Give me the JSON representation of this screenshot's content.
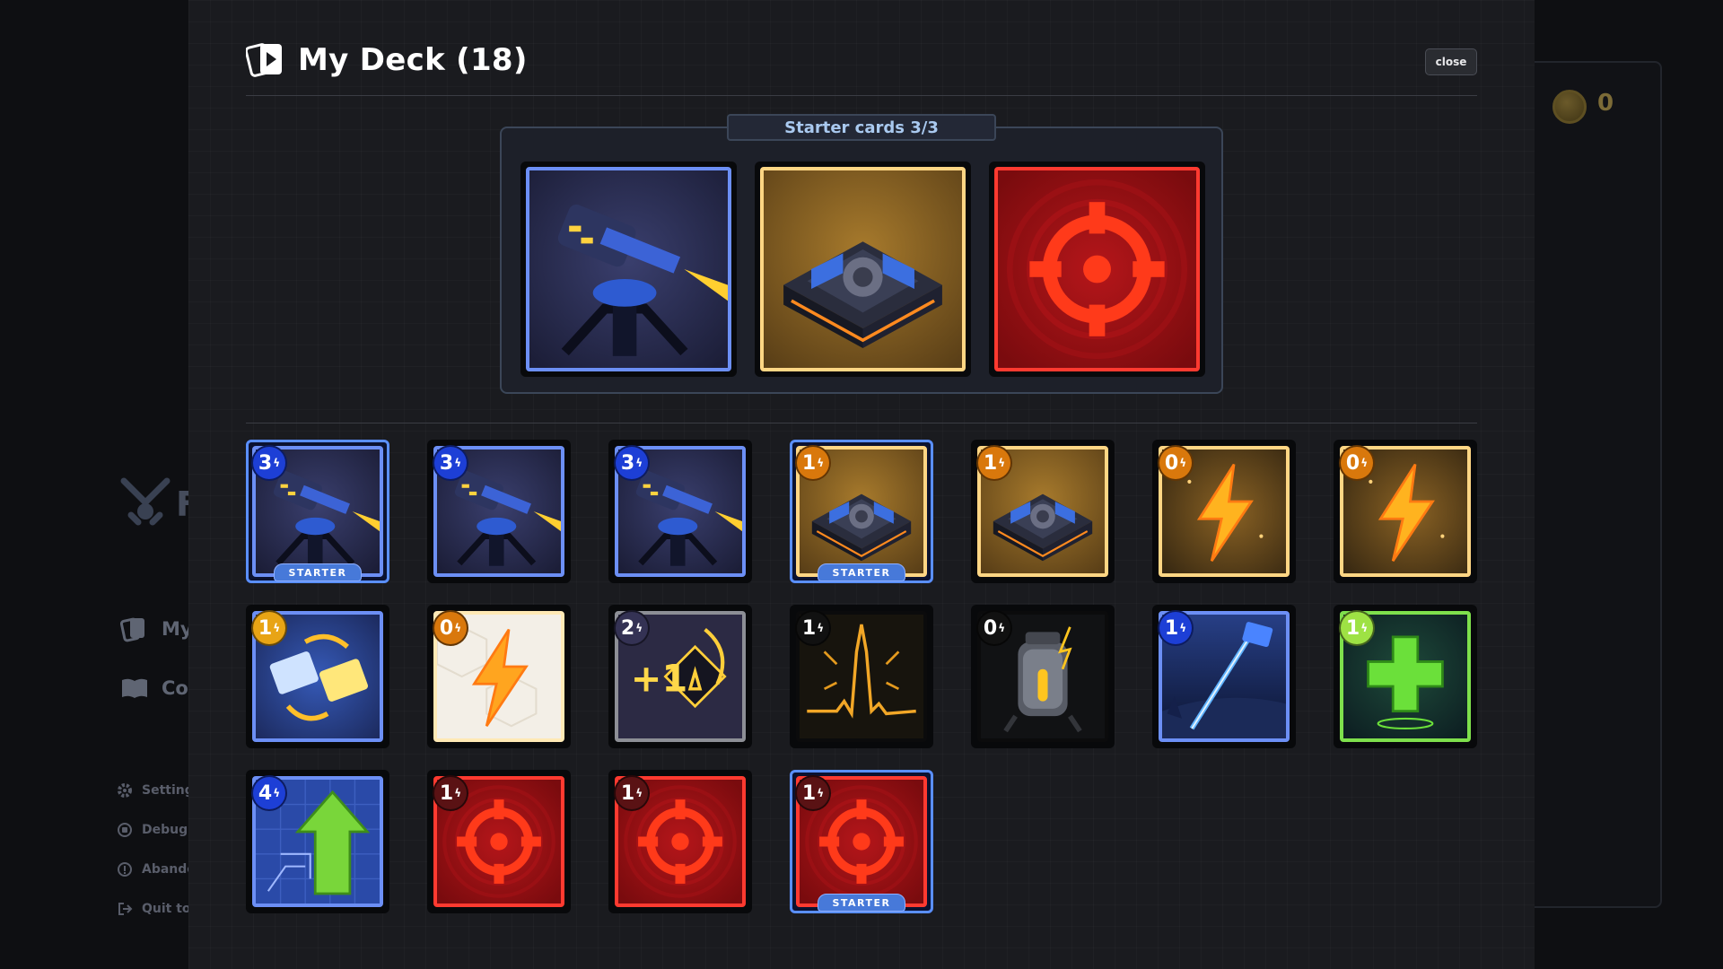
{
  "background": {
    "logo_letter": "F",
    "nav": [
      {
        "label": "My",
        "icon": "deck-icon"
      },
      {
        "label": "Col",
        "icon": "book-icon"
      }
    ],
    "menu": [
      {
        "label": "Settings",
        "icon": "gear-icon"
      },
      {
        "label": "Debug",
        "icon": "debug-icon"
      },
      {
        "label": "Abando",
        "icon": "info-icon"
      },
      {
        "label": "Quit to I",
        "icon": "exit-icon"
      }
    ],
    "currency_value": "0"
  },
  "modal": {
    "title": "My Deck (18)",
    "close_label": "close",
    "starter_section_label": "Starter cards 3/3"
  },
  "starter_cards": [
    {
      "art": "turret",
      "frame": "blue"
    },
    {
      "art": "generator",
      "frame": "gold"
    },
    {
      "art": "target",
      "frame": "red"
    }
  ],
  "deck_cards": [
    {
      "cost": "3",
      "cost_color": "blue",
      "art": "turret",
      "frame": "blue",
      "starter": true
    },
    {
      "cost": "3",
      "cost_color": "blue",
      "art": "turret",
      "frame": "blue",
      "starter": false
    },
    {
      "cost": "3",
      "cost_color": "blue",
      "art": "turret",
      "frame": "blue",
      "starter": false
    },
    {
      "cost": "1",
      "cost_color": "orange",
      "art": "generator",
      "frame": "gold",
      "starter": true
    },
    {
      "cost": "1",
      "cost_color": "orange",
      "art": "generator",
      "frame": "gold",
      "starter": false
    },
    {
      "cost": "0",
      "cost_color": "orange",
      "art": "bolt",
      "frame": "gold",
      "starter": false
    },
    {
      "cost": "0",
      "cost_color": "orange",
      "art": "bolt",
      "frame": "gold",
      "starter": false
    },
    {
      "cost": "1",
      "cost_color": "gold",
      "art": "swap",
      "frame": "blue",
      "starter": false
    },
    {
      "cost": "0",
      "cost_color": "orange",
      "art": "bolt-white",
      "frame": "white",
      "starter": false
    },
    {
      "cost": "2",
      "cost_color": "purple",
      "art": "plus-one",
      "frame": "gray",
      "starter": false
    },
    {
      "cost": "1",
      "cost_color": "black",
      "art": "spike",
      "frame": "black",
      "starter": false
    },
    {
      "cost": "0",
      "cost_color": "black",
      "art": "capacitor",
      "frame": "black",
      "starter": false
    },
    {
      "cost": "1",
      "cost_color": "blue",
      "art": "beam",
      "frame": "blue",
      "starter": false
    },
    {
      "cost": "1",
      "cost_color": "green",
      "art": "heal",
      "frame": "green",
      "starter": false
    },
    {
      "cost": "4",
      "cost_color": "blue",
      "art": "upgrade",
      "frame": "blue",
      "starter": false
    },
    {
      "cost": "1",
      "cost_color": "dred",
      "art": "target",
      "frame": "red",
      "starter": false
    },
    {
      "cost": "1",
      "cost_color": "dred",
      "art": "target",
      "frame": "red",
      "starter": false
    },
    {
      "cost": "1",
      "cost_color": "dred",
      "art": "target",
      "frame": "red",
      "starter": true
    }
  ],
  "starter_badge_label": "STARTER",
  "bolt_glyph": "ϟ"
}
